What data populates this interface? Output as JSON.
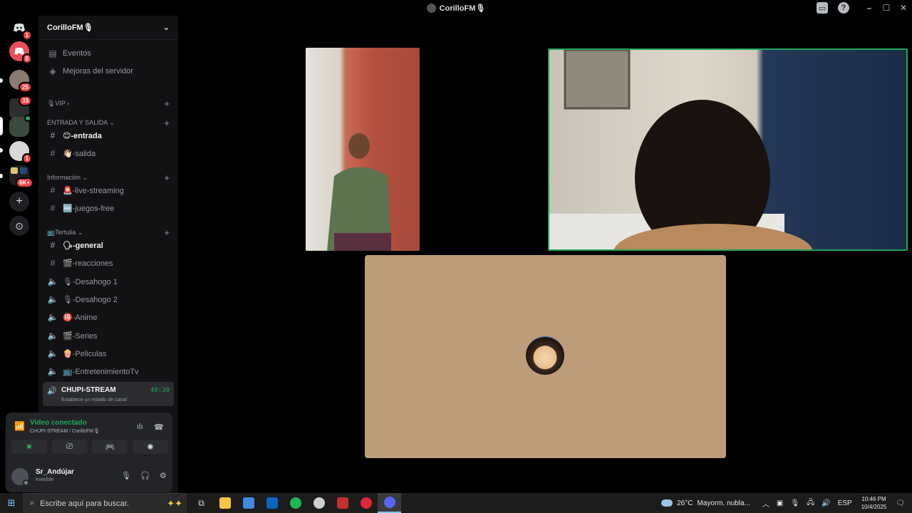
{
  "window": {
    "title": "CorilloFM🎙",
    "controls": [
      "–",
      "☐",
      "✕"
    ]
  },
  "servers": {
    "items": [
      {
        "icon": "discord-home-icon",
        "badge": "1"
      },
      {
        "icon": "discord-server-icon",
        "badge": "8"
      },
      {
        "icon": "server-avatar-icon",
        "badge": "25"
      },
      {
        "icon": "server-avatar-icon",
        "badge": "33"
      },
      {
        "icon": "server-avatar-icon",
        "badge": ""
      },
      {
        "icon": "server-avatar-icon",
        "badge": "1"
      },
      {
        "icon": "server-folder-icon",
        "badge": "6K+"
      }
    ],
    "add_label": "+",
    "explore_label": "⊙"
  },
  "guild": {
    "name": "CorilloFM🎙",
    "chevron": "⌄"
  },
  "top_links": [
    {
      "icon": "calendar-icon",
      "label": "Eventos"
    },
    {
      "icon": "boost-icon",
      "label": "Mejoras del servidor"
    }
  ],
  "categories": {
    "vip": "🎙VIP",
    "entrada": "ENTRADA Y SALIDA",
    "informacion": "Información",
    "tertulia": "📺Tertulia"
  },
  "channels": {
    "entrada": "😊-entrada",
    "salida": "👋🏻-salida",
    "live_streaming": "🚨-live-streaming",
    "juegos_free": "🆓-juegos-free",
    "general": "🗣-general",
    "reacciones": "🎬-reacciones",
    "desahogo1": "🎙-Desahogo 1",
    "desahogo2": "🎙-Desahogo 2",
    "anime": "🉐-Anime",
    "series": "🎬-Series",
    "peliculas": "🍿-Peliculas",
    "entretenimiento": "📺-EntretenimientoTv"
  },
  "active_voice": {
    "name": "CHUPI-STREAM",
    "timer": "40:30",
    "status": "Establece un estado de canal"
  },
  "voice_panel": {
    "title": "Video conectado",
    "subtitle": "CHUPI-STREAM / CorilloFM🎙"
  },
  "user": {
    "name": "Sr_Andújar",
    "status": "Invisible"
  },
  "taskbar": {
    "search_placeholder": "Escribe aquí para buscar.",
    "weather_temp": "26°C",
    "weather_desc": "Mayorm. nubla...",
    "lang": "ESP",
    "time": "10:46 PM",
    "date": "10/4/2025"
  },
  "colors": {
    "accent_green": "#23a55a",
    "badge_red": "#f23f43",
    "blurple": "#5865f2"
  }
}
